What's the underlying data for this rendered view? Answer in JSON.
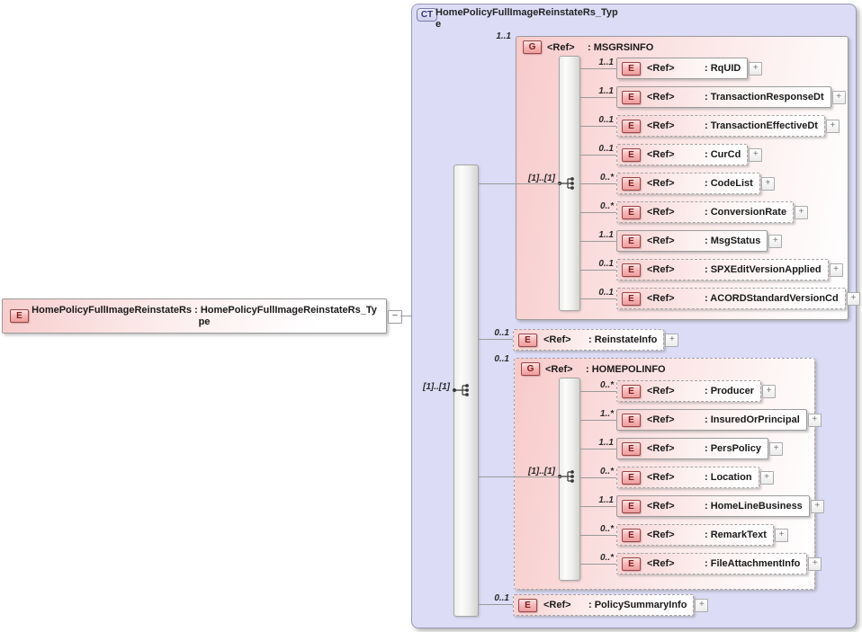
{
  "diagram": {
    "expand_glyph": "+",
    "root_element": {
      "badge": "E",
      "label": "HomePolicyFullImageReinstateRs : HomePolicyFullImageReinstateRs_Type",
      "collapse_glyph": "−"
    },
    "complex_type": {
      "badge": "CT",
      "title": "HomePolicyFullImageReinstateRs_Type",
      "model_cardinality": "[1]..[1]",
      "children": [
        {
          "kind": "group",
          "badge": "G",
          "ref_label": "<Ref>",
          "name": ": MSGRSINFO",
          "cardinality": "1..1",
          "optional": false,
          "model_cardinality": "[1]..[1]",
          "children": [
            {
              "badge": "E",
              "ref_label": "<Ref>",
              "name": ": RqUID",
              "cardinality": "1..1",
              "optional": false
            },
            {
              "badge": "E",
              "ref_label": "<Ref>",
              "name": ": TransactionResponseDt",
              "cardinality": "1..1",
              "optional": false
            },
            {
              "badge": "E",
              "ref_label": "<Ref>",
              "name": ": TransactionEffectiveDt",
              "cardinality": "0..1",
              "optional": true
            },
            {
              "badge": "E",
              "ref_label": "<Ref>",
              "name": ": CurCd",
              "cardinality": "0..1",
              "optional": true
            },
            {
              "badge": "E",
              "ref_label": "<Ref>",
              "name": ": CodeList",
              "cardinality": "0..*",
              "optional": true
            },
            {
              "badge": "E",
              "ref_label": "<Ref>",
              "name": ": ConversionRate",
              "cardinality": "0..*",
              "optional": true
            },
            {
              "badge": "E",
              "ref_label": "<Ref>",
              "name": ": MsgStatus",
              "cardinality": "1..1",
              "optional": false
            },
            {
              "badge": "E",
              "ref_label": "<Ref>",
              "name": ": SPXEditVersionApplied",
              "cardinality": "0..1",
              "optional": true
            },
            {
              "badge": "E",
              "ref_label": "<Ref>",
              "name": ": ACORDStandardVersionCd",
              "cardinality": "0..1",
              "optional": true
            }
          ]
        },
        {
          "kind": "element",
          "badge": "E",
          "ref_label": "<Ref>",
          "name": ": ReinstateInfo",
          "cardinality": "0..1",
          "optional": true
        },
        {
          "kind": "group",
          "badge": "G",
          "ref_label": "<Ref>",
          "name": ": HOMEPOLINFO",
          "cardinality": "0..1",
          "optional": true,
          "model_cardinality": "[1]..[1]",
          "children": [
            {
              "badge": "E",
              "ref_label": "<Ref>",
              "name": ": Producer",
              "cardinality": "0..*",
              "optional": true
            },
            {
              "badge": "E",
              "ref_label": "<Ref>",
              "name": ": InsuredOrPrincipal",
              "cardinality": "1..*",
              "optional": false
            },
            {
              "badge": "E",
              "ref_label": "<Ref>",
              "name": ": PersPolicy",
              "cardinality": "1..1",
              "optional": false
            },
            {
              "badge": "E",
              "ref_label": "<Ref>",
              "name": ": Location",
              "cardinality": "0..*",
              "optional": true
            },
            {
              "badge": "E",
              "ref_label": "<Ref>",
              "name": ": HomeLineBusiness",
              "cardinality": "1..1",
              "optional": false
            },
            {
              "badge": "E",
              "ref_label": "<Ref>",
              "name": ": RemarkText",
              "cardinality": "0..*",
              "optional": true
            },
            {
              "badge": "E",
              "ref_label": "<Ref>",
              "name": ": FileAttachmentInfo",
              "cardinality": "0..*",
              "optional": true
            }
          ]
        },
        {
          "kind": "element",
          "badge": "E",
          "ref_label": "<Ref>",
          "name": ": PolicySummaryInfo",
          "cardinality": "0..1",
          "optional": true
        }
      ]
    },
    "colors": {
      "container_fill": "#dcdcf7",
      "container_border": "#9a9ab8",
      "pink_fill": "#f8caca",
      "badge_border": "#9a4545",
      "badge_text": "#7c2020",
      "ct_badge_text": "#32327a",
      "connector_line": "#9a9a9a"
    }
  }
}
